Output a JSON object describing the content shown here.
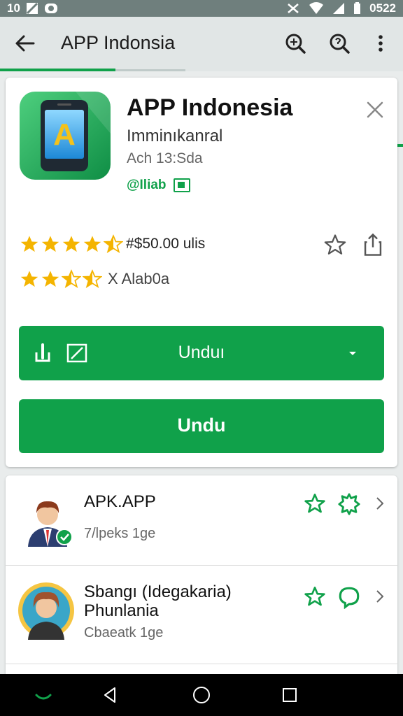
{
  "status_bar": {
    "left_text": "10",
    "time": "0522"
  },
  "app_bar": {
    "title": "APP Indonsia"
  },
  "app": {
    "name": "APP Indonesia",
    "developer": "Imminıkanral",
    "meta": "Ach 13:Sda",
    "badge": "@Iliab",
    "icon_letter": "A",
    "rating_text": "#$50.00 ulis",
    "rating_value": 4.5,
    "rating_text_2": "X Alab0a",
    "rating_value_2": 3.5
  },
  "buttons": {
    "split_label": "Unduı",
    "full_label": "Undu"
  },
  "related": [
    {
      "title": "APK.APP",
      "subtitle": "7/lpeks 1ge"
    },
    {
      "title": "Sbangı (Idegakaria)\nPhunlania",
      "subtitle": "Cbaeatk 1ge"
    }
  ],
  "colors": {
    "accent": "#10a14a",
    "star": "#f4b400"
  },
  "icons": {
    "back": "arrow-left-icon",
    "search": "search-icon",
    "search_alt": "search-help-icon",
    "more": "more-vertical-icon",
    "close": "close-icon",
    "wishlist": "star-outline-icon",
    "share": "share-icon"
  }
}
